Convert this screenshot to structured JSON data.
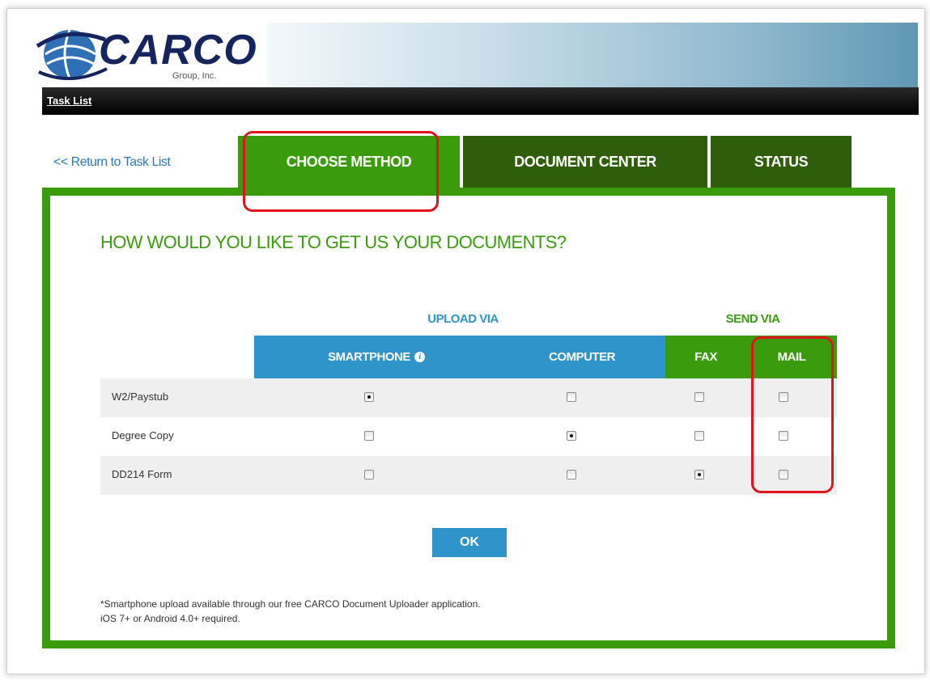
{
  "brand": {
    "name": "CARCO",
    "sub": "Group, Inc."
  },
  "nav": {
    "task_list": "Task List"
  },
  "tabs": {
    "return_link": "<< Return to Task List",
    "choose_method": "CHOOSE METHOD",
    "document_center": "DOCUMENT CENTER",
    "status": "STATUS"
  },
  "question": "HOW WOULD YOU LIKE TO GET US YOUR DOCUMENTS?",
  "groups": {
    "upload": "UPLOAD VIA",
    "send": "SEND VIA"
  },
  "columns": {
    "smartphone": "SMARTPHONE",
    "computer": "COMPUTER",
    "fax": "FAX",
    "mail": "MAIL"
  },
  "rows": [
    {
      "label": "W2/Paystub",
      "selected": "smartphone"
    },
    {
      "label": "Degree Copy",
      "selected": "computer"
    },
    {
      "label": "DD214 Form",
      "selected": "fax"
    }
  ],
  "ok_label": "OK",
  "footnote": {
    "line1": "*Smartphone upload available through our free CARCO Document Uploader application.",
    "line2": "iOS 7+ or Android 4.0+ required."
  },
  "colors": {
    "green": "#3a9b0d",
    "dark_green": "#2f5e0a",
    "blue": "#2f94c9",
    "highlight": "#e0141c"
  }
}
